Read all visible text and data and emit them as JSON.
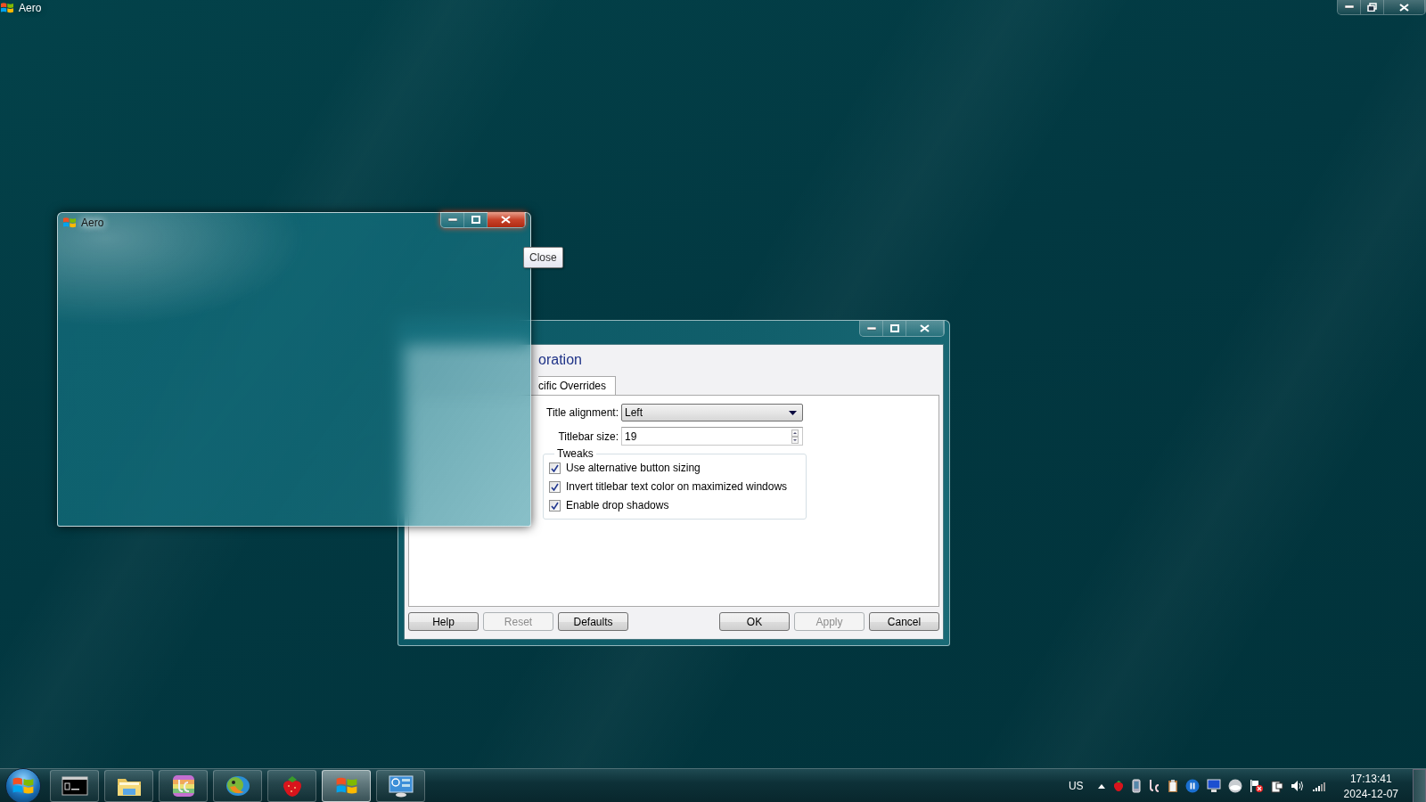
{
  "top_bar": {
    "title": "Aero"
  },
  "aero_window": {
    "title": "Aero",
    "tooltip": "Close"
  },
  "dialog": {
    "heading": "oration",
    "tabs": [
      {
        "label": "cific Overrides",
        "selected": true
      }
    ],
    "fields": [
      {
        "kind": "dropdown",
        "label": "Title alignment:",
        "value": "Left"
      },
      {
        "kind": "spinner",
        "label": "Titlebar size:",
        "value": "19"
      }
    ],
    "group": {
      "title": "Tweaks",
      "options": [
        {
          "label": "Use alternative button sizing",
          "checked": true
        },
        {
          "label": "Invert titlebar text color on maximized windows",
          "checked": true
        },
        {
          "label": "Enable drop shadows",
          "checked": true
        }
      ]
    },
    "buttons_left": [
      {
        "label": "Help",
        "disabled": false
      },
      {
        "label": "Reset",
        "disabled": true
      },
      {
        "label": "Defaults",
        "disabled": false
      }
    ],
    "buttons_right": [
      {
        "label": "OK",
        "disabled": false
      },
      {
        "label": "Apply",
        "disabled": true
      },
      {
        "label": "Cancel",
        "disabled": false
      }
    ]
  },
  "taskbar": {
    "apps": [
      {
        "kind": "terminal",
        "selected": false
      },
      {
        "kind": "folder",
        "selected": false
      },
      {
        "kind": "uc",
        "selected": false
      },
      {
        "kind": "parrot",
        "selected": false
      },
      {
        "kind": "strawberry",
        "selected": false
      },
      {
        "kind": "windows",
        "selected": true
      },
      {
        "kind": "panel",
        "selected": false
      }
    ],
    "tray": {
      "language": "US",
      "time": "17:13:41",
      "date": "2024-12-07"
    }
  }
}
